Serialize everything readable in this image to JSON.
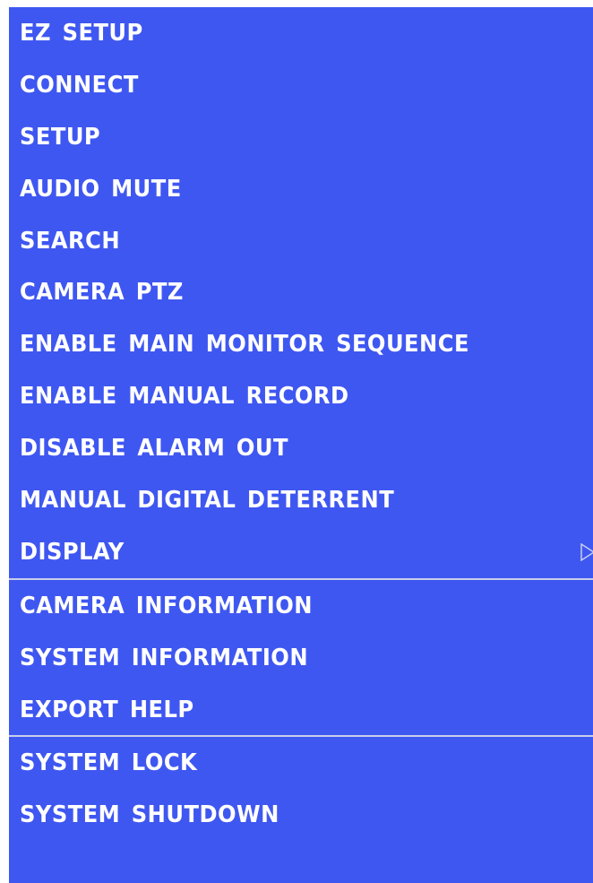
{
  "menu": {
    "groups": [
      {
        "items": [
          {
            "label": "EZ  SETUP"
          },
          {
            "label": "CONNECT"
          },
          {
            "label": "SETUP"
          },
          {
            "label": "AUDIO  MUTE"
          },
          {
            "label": "SEARCH"
          },
          {
            "label": "CAMERA  PTZ"
          },
          {
            "label": "ENABLE  MAIN  MONITOR  SEQUENCE"
          },
          {
            "label": "ENABLE  MANUAL  RECORD"
          },
          {
            "label": "DISABLE  ALARM  OUT"
          },
          {
            "label": "MANUAL  DIGITAL  DETERRENT"
          },
          {
            "label": "DISPLAY",
            "submenu_icon": "triangle-right-outline-icon"
          }
        ]
      },
      {
        "items": [
          {
            "label": "CAMERA  INFORMATION"
          },
          {
            "label": "SYSTEM  INFORMATION"
          },
          {
            "label": "EXPORT  HELP"
          }
        ]
      },
      {
        "items": [
          {
            "label": "SYSTEM  LOCK"
          },
          {
            "label": "SYSTEM  SHUTDOWN"
          }
        ]
      }
    ]
  },
  "colors": {
    "menu_background": "#3f57f1",
    "text": "#ffffff",
    "divider": "#c8ceea"
  }
}
